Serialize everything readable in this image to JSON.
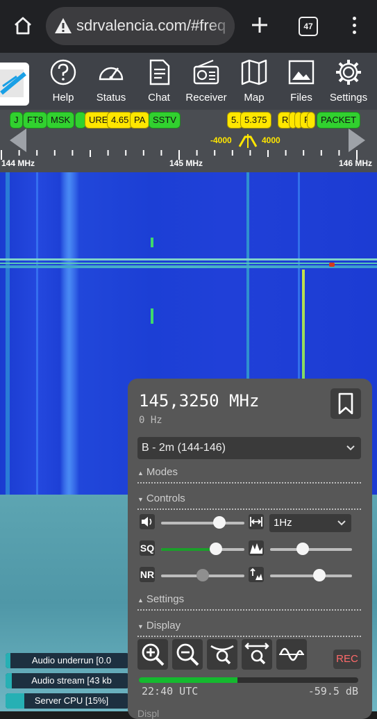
{
  "browser": {
    "url": "sdrvalencia.com/#freq",
    "tab_count": "47"
  },
  "nav": [
    {
      "label": "Help",
      "icon": "help-icon"
    },
    {
      "label": "Status",
      "icon": "gauge-icon"
    },
    {
      "label": "Chat",
      "icon": "chat-icon"
    },
    {
      "label": "Receiver",
      "icon": "radio-icon"
    },
    {
      "label": "Map",
      "icon": "map-icon"
    },
    {
      "label": "Files",
      "icon": "image-files-icon"
    },
    {
      "label": "Settings",
      "icon": "gear-icon"
    }
  ],
  "bookmarks": [
    {
      "label": "J",
      "color": "green"
    },
    {
      "label": "FT8",
      "color": "green"
    },
    {
      "label": "MSK",
      "color": "green"
    },
    {
      "label": "URE",
      "color": "yellow"
    },
    {
      "label": "4.65",
      "color": "yellow"
    },
    {
      "label": "PA",
      "color": "yellow"
    },
    {
      "label": "SSTV",
      "color": "green"
    },
    {
      "label": "5.",
      "color": "yellow"
    },
    {
      "label": "5.375",
      "color": "yellow"
    },
    {
      "label": "R",
      "color": "yellow"
    },
    {
      "label": "F",
      "color": "yellow"
    },
    {
      "label": "PACKET",
      "color": "green"
    }
  ],
  "scale": {
    "left": "144 MHz",
    "center": "145 MHz",
    "right": "146 MHz",
    "filter_low": "-4000",
    "filter_high": "4000"
  },
  "status_bars": [
    {
      "text": "Audio underrun [0.0",
      "level": 0.0
    },
    {
      "text": "Audio stream [43 kb",
      "level": 0.05
    },
    {
      "text": "Server CPU [15%]",
      "level": 0.15
    }
  ],
  "panel": {
    "frequency": "145,3250 MHz",
    "offset": "0 Hz",
    "profile": "B - 2m (144-146)",
    "sections": {
      "modes": "Modes",
      "controls": "Controls",
      "settings": "Settings",
      "display": "Display",
      "next": "Displ"
    },
    "controls": {
      "sq_label": "SQ",
      "nr_label": "NR",
      "step": "1Hz",
      "volume_level": 0.7,
      "squelch_level": 0.66,
      "nr_level": 0.5,
      "agc_level": 0.4,
      "gain_level": 0.6
    },
    "rec_label": "REC",
    "smeter_level": 0.45,
    "clock": "22:40 UTC",
    "db": "-59.5 dB"
  }
}
